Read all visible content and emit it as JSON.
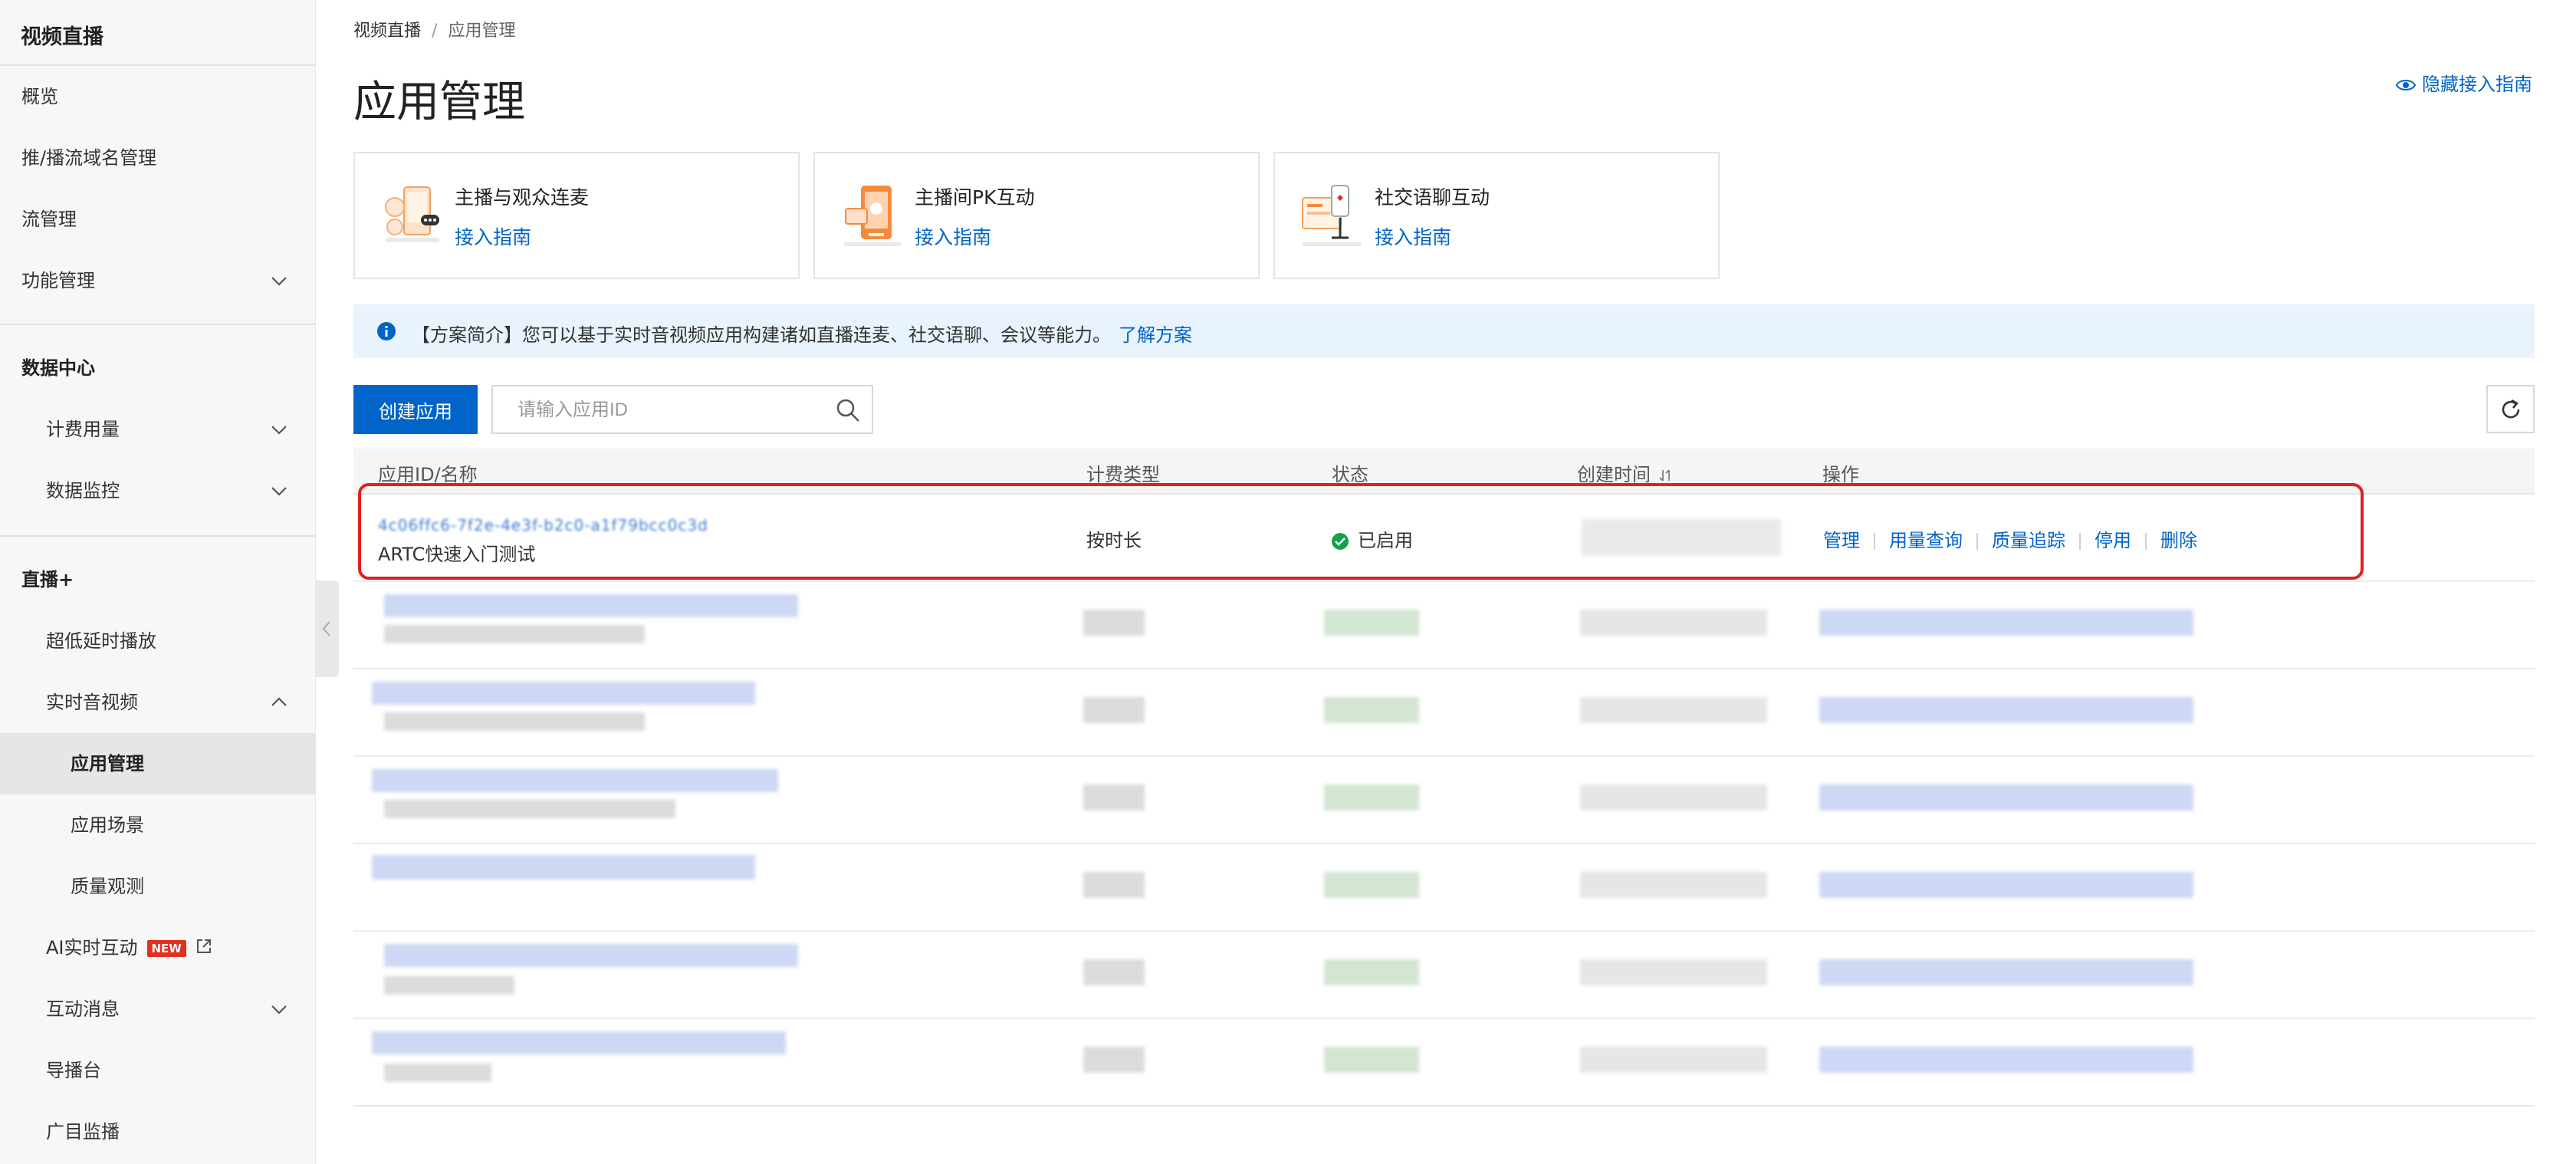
{
  "sidebar": {
    "title": "视频直播",
    "items": [
      {
        "label": "概览"
      },
      {
        "label": "推/播流域名管理"
      },
      {
        "label": "流管理"
      },
      {
        "label": "功能管理"
      },
      {
        "label": "数据中心"
      },
      {
        "label": "计费用量"
      },
      {
        "label": "数据监控"
      },
      {
        "label": "直播+"
      },
      {
        "label": "超低延时播放"
      },
      {
        "label": "实时音视频"
      },
      {
        "label": "应用管理"
      },
      {
        "label": "应用场景"
      },
      {
        "label": "质量观测"
      },
      {
        "label": "AI实时互动",
        "badge": "NEW"
      },
      {
        "label": "互动消息"
      },
      {
        "label": "导播台"
      },
      {
        "label": "广目监播"
      }
    ]
  },
  "breadcrumb": {
    "root": "视频直播",
    "separator": "/",
    "current": "应用管理"
  },
  "header": {
    "title": "应用管理",
    "hide_guide": "隐藏接入指南"
  },
  "guide_cards": [
    {
      "title": "主播与观众连麦",
      "link": "接入指南"
    },
    {
      "title": "主播间PK互动",
      "link": "接入指南"
    },
    {
      "title": "社交语聊互动",
      "link": "接入指南"
    }
  ],
  "info_bar": {
    "text": "【方案简介】您可以基于实时音视频应用构建诸如直播连麦、社交语聊、会议等能力。",
    "link": "了解方案"
  },
  "toolbar": {
    "create_label": "创建应用",
    "search_placeholder": "请输入应用ID"
  },
  "table": {
    "columns": [
      "应用ID/名称",
      "计费类型",
      "状态",
      "创建时间",
      "操作"
    ],
    "highlighted_row": {
      "app_id": "4c06ffc6-7f2e-4e3f-b2c0-a1f79bcc0c3d",
      "name": "ARTC快速入门测试",
      "billing": "按时长",
      "status": "已启用",
      "actions": [
        "管理",
        "用量查询",
        "质量追踪",
        "停用",
        "删除"
      ]
    }
  },
  "colors": {
    "accent": "#0064c8",
    "status_ok": "#15a24a",
    "highlight": "#e02020",
    "badge": "#e0301e"
  }
}
